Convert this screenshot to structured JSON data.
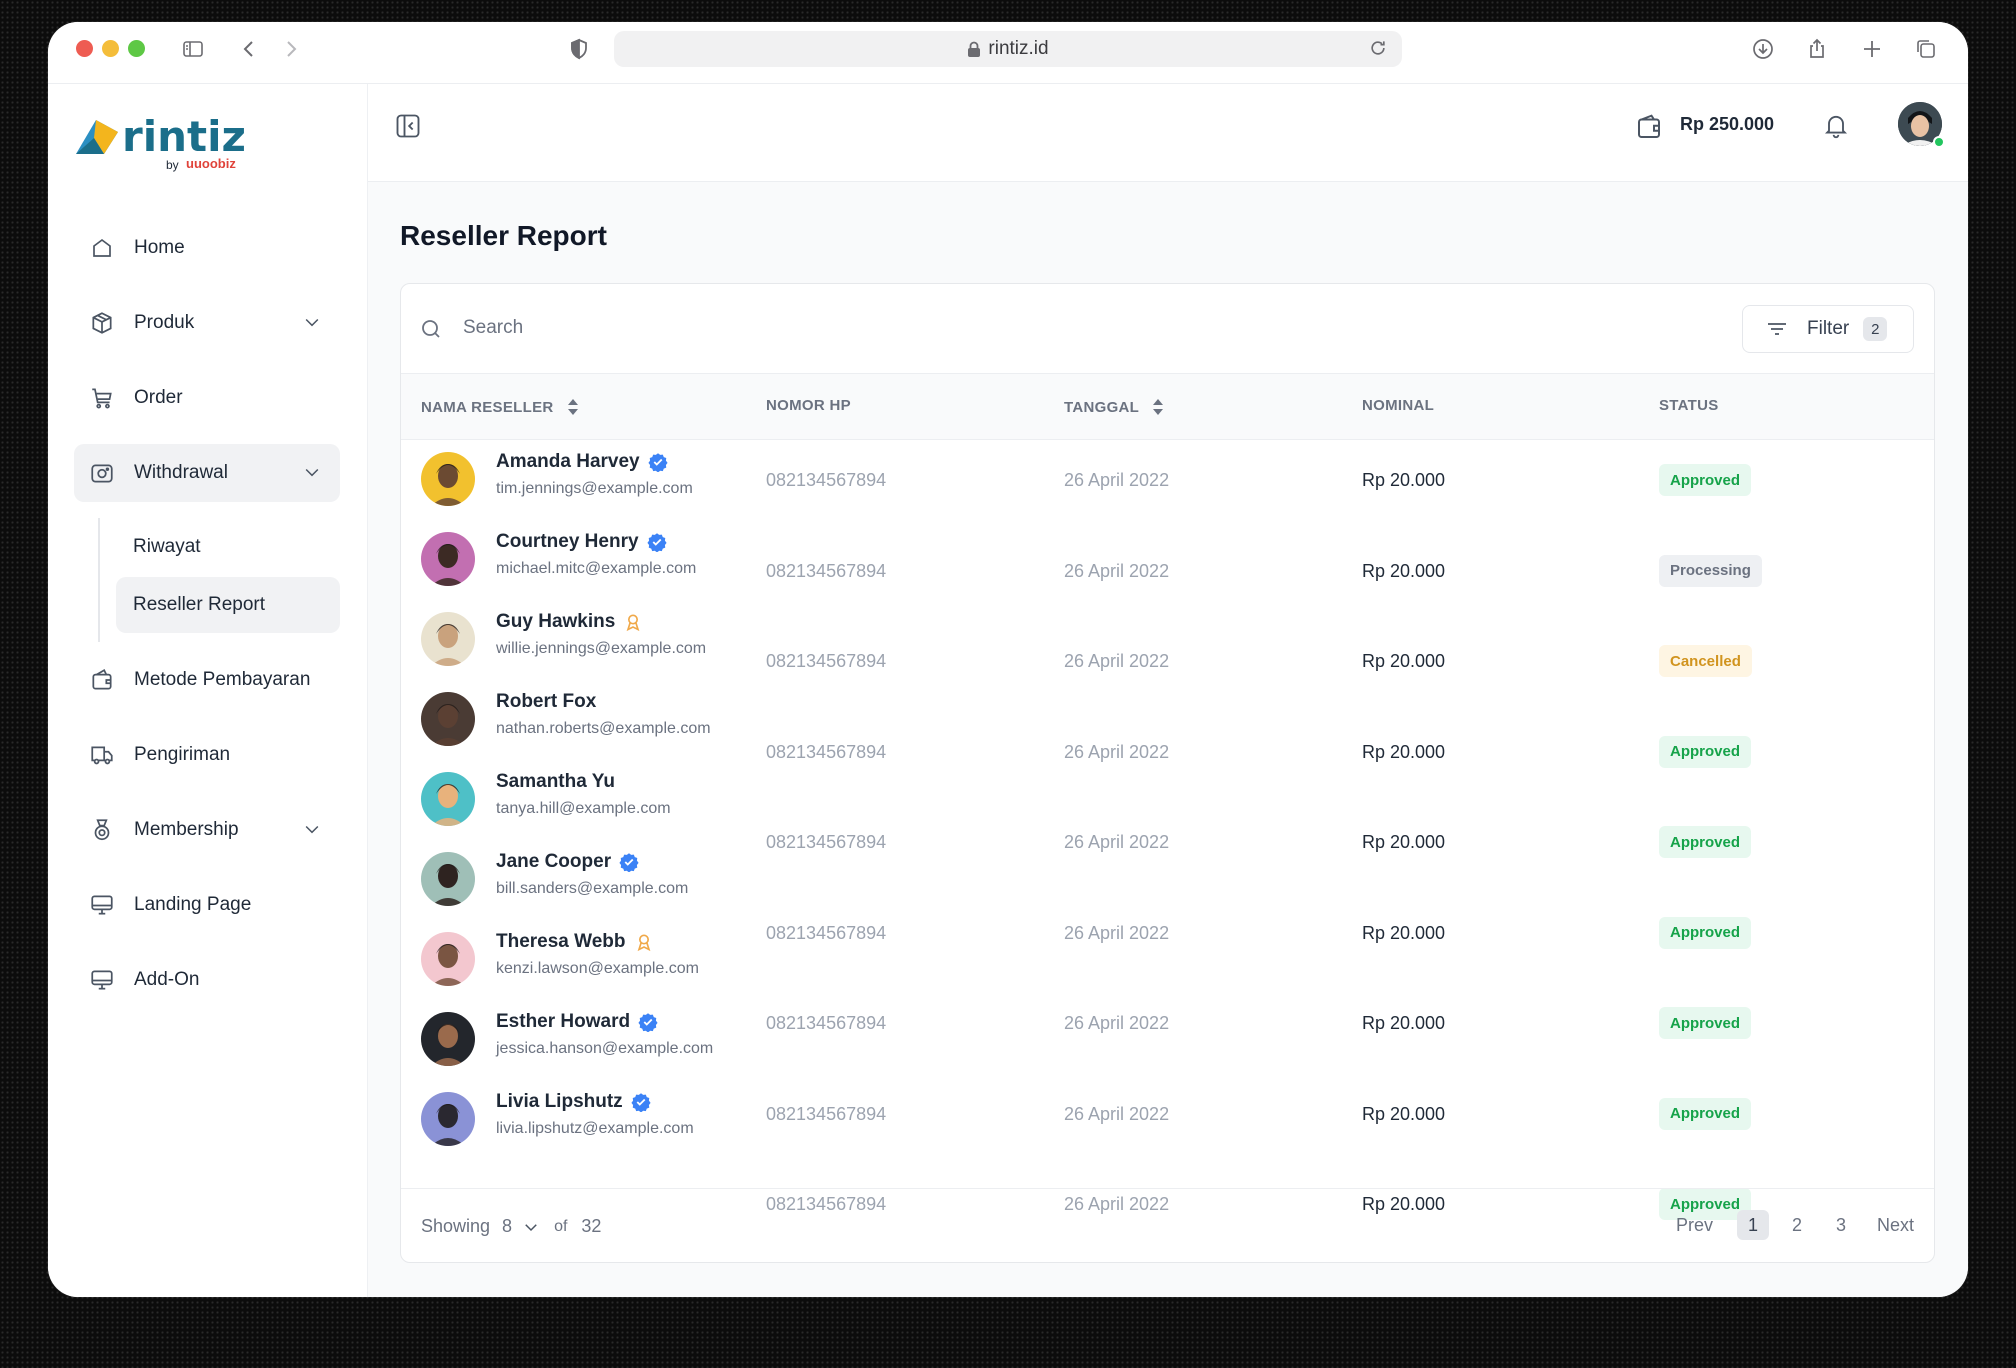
{
  "browser": {
    "url": "rintiz.id"
  },
  "brand": {
    "name": "rintiz",
    "by": "by",
    "partner": "uuoobiz"
  },
  "sidebar": {
    "items": [
      {
        "label": "Home",
        "icon": "home-icon"
      },
      {
        "label": "Produk",
        "icon": "box-icon",
        "expandable": true
      },
      {
        "label": "Order",
        "icon": "cart-icon"
      },
      {
        "label": "Withdrawal",
        "icon": "camera-icon",
        "expandable": true,
        "active": true
      },
      {
        "label": "Metode Pembayaran",
        "icon": "wallet-icon"
      },
      {
        "label": "Pengiriman",
        "icon": "truck-icon"
      },
      {
        "label": "Membership",
        "icon": "medal-icon",
        "expandable": true
      },
      {
        "label": "Landing Page",
        "icon": "monitor-icon"
      },
      {
        "label": "Add-On",
        "icon": "monitor-icon"
      }
    ],
    "withdrawal_sub": [
      {
        "label": "Riwayat"
      },
      {
        "label": "Reseller Report",
        "active": true
      }
    ]
  },
  "topbar": {
    "balance": "Rp 250.000"
  },
  "page": {
    "title": "Reseller Report"
  },
  "search": {
    "placeholder": "Search",
    "value": ""
  },
  "filter": {
    "label": "Filter",
    "count": "2"
  },
  "table": {
    "columns": [
      "NAMA RESELLER",
      "NOMOR HP",
      "TANGGAL",
      "NOMINAL",
      "STATUS"
    ],
    "rows": [
      {
        "name": "Amanda Harvey",
        "email": "tim.jennings@example.com",
        "badge": "verified",
        "phone": "082134567894",
        "date": "26 April 2022",
        "nominal": "Rp 20.000",
        "status": "Approved",
        "avatar_color": "#f2c12e",
        "skin": "#6b4a32"
      },
      {
        "name": "Courtney Henry",
        "email": "michael.mitc@example.com",
        "badge": "verified",
        "phone": "082134567894",
        "date": "26 April 2022",
        "nominal": "Rp 20.000",
        "status": "Processing",
        "avatar_color": "#c26fb1",
        "skin": "#3c2a24"
      },
      {
        "name": "Guy Hawkins",
        "email": "willie.jennings@example.com",
        "badge": "award",
        "phone": "082134567894",
        "date": "26 April 2022",
        "nominal": "Rp 20.000",
        "status": "Cancelled",
        "avatar_color": "#e9e2cf",
        "skin": "#c9a27d"
      },
      {
        "name": "Robert Fox",
        "email": "nathan.roberts@example.com",
        "badge": "",
        "phone": "082134567894",
        "date": "26 April 2022",
        "nominal": "Rp 20.000",
        "status": "Approved",
        "avatar_color": "#4a3b34",
        "skin": "#5b4033"
      },
      {
        "name": "Samantha Yu",
        "email": "tanya.hill@example.com",
        "badge": "",
        "phone": "082134567894",
        "date": "26 April 2022",
        "nominal": "Rp 20.000",
        "status": "Approved",
        "avatar_color": "#4ec0c7",
        "skin": "#e8b27c"
      },
      {
        "name": "Jane Cooper",
        "email": "bill.sanders@example.com",
        "badge": "verified",
        "phone": "082134567894",
        "date": "26 April 2022",
        "nominal": "Rp 20.000",
        "status": "Approved",
        "avatar_color": "#9fbfb7",
        "skin": "#2e2320"
      },
      {
        "name": "Theresa Webb",
        "email": "kenzi.lawson@example.com",
        "badge": "award",
        "phone": "082134567894",
        "date": "26 April 2022",
        "nominal": "Rp 20.000",
        "status": "Approved",
        "avatar_color": "#f3c7cf",
        "skin": "#7a5542"
      },
      {
        "name": "Esther Howard",
        "email": "jessica.hanson@example.com",
        "badge": "verified",
        "phone": "082134567894",
        "date": "26 April 2022",
        "nominal": "Rp 20.000",
        "status": "Approved",
        "avatar_color": "#23262c",
        "skin": "#9a6a4c"
      },
      {
        "name": "Livia Lipshutz",
        "email": "livia.lipshutz@example.com",
        "badge": "verified",
        "phone": "082134567894",
        "date": "26 April 2022",
        "nominal": "Rp 20.000",
        "status": "Approved",
        "avatar_color": "#8a92d6",
        "skin": "#2a2830"
      }
    ]
  },
  "pagination": {
    "showing_label": "Showing",
    "per_page": "8",
    "of_label": "of",
    "total": "32",
    "prev": "Prev",
    "pages": [
      "1",
      "2",
      "3"
    ],
    "current": "1",
    "next": "Next"
  },
  "colors": {
    "accent_blue": "#3b82f6",
    "brand_teal": "#1b6e8a",
    "brand_red": "#e0433a",
    "approved": "#16a34a",
    "cancelled": "#d1941f"
  }
}
